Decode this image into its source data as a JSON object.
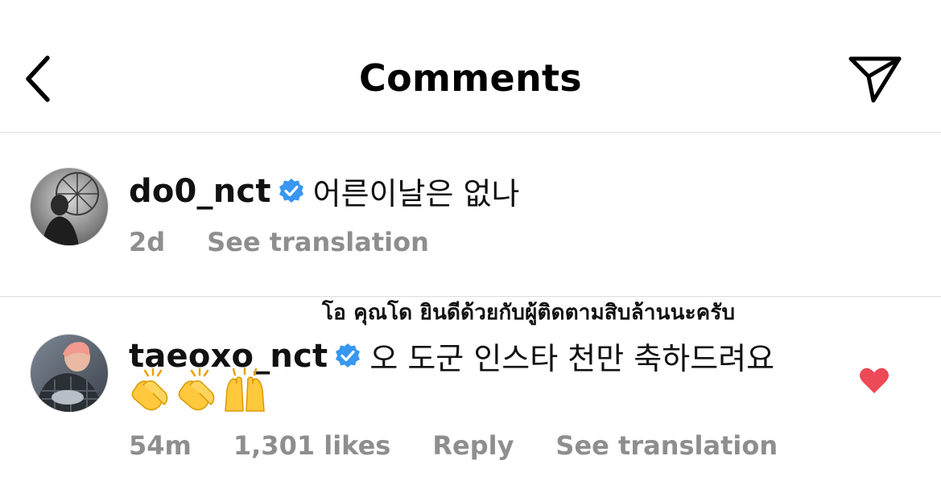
{
  "header": {
    "title": "Comments",
    "back_icon": "chevron-left-icon",
    "share_icon": "paper-plane-icon"
  },
  "overlay_caption": "โอ คุณโด ยินดีด้วยกับผู้ติดตามสิบล้านนะครับ",
  "comments": [
    {
      "username": "do0_nct",
      "verified": true,
      "text": "어른이날은 없나",
      "time": "2d",
      "see_translation": "See translation"
    },
    {
      "username": "taeoxo_nct",
      "verified": true,
      "text": "오 도군 인스타 천만 축하드려요",
      "emojis": [
        "clapping-hands",
        "clapping-hands",
        "raising-hands"
      ],
      "time": "54m",
      "likes": "1,301 likes",
      "reply": "Reply",
      "see_translation": "See translation",
      "liked": true
    }
  ],
  "colors": {
    "verified_blue": "#3897f0",
    "like_red": "#ed4956",
    "meta_gray": "#8e8e8e",
    "divider": "#dcdcdc"
  }
}
